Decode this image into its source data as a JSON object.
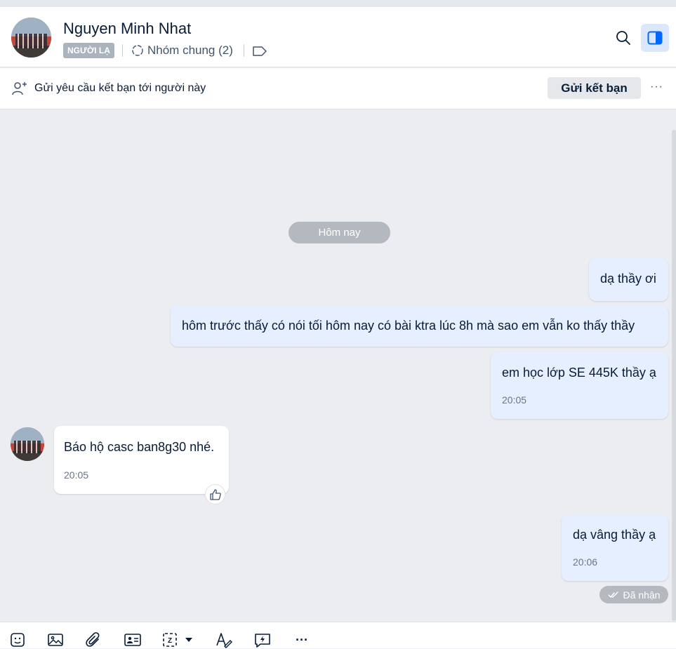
{
  "header": {
    "contact_name": "Nguyen Minh Nhat",
    "badge": "NGƯỜI LẠ",
    "group_label": "Nhóm chung (2)"
  },
  "friend_bar": {
    "text": "Gửi yêu cầu kết bạn tới người này",
    "button_label": "Gửi kết bạn",
    "more_label": "···"
  },
  "chat": {
    "date_divider": "Hôm nay",
    "messages": [
      {
        "from": "me",
        "text": "dạ thầy ơi"
      },
      {
        "from": "me",
        "text": "hôm trước thấy có nói tối hôm nay có bài ktra lúc 8h mà sao em vẫn ko thấy thầy"
      },
      {
        "from": "me",
        "text": "em học lớp SE 445K thầy ạ",
        "time": "20:05"
      },
      {
        "from": "them",
        "text": "Báo hộ casc ban8g30 nhé.",
        "time": "20:05"
      },
      {
        "from": "me",
        "text": "dạ vâng thầy ạ",
        "time": "20:06"
      }
    ],
    "status": "Đã nhận"
  },
  "toolbar": {
    "items": [
      "sticker-icon",
      "image-icon",
      "attachment-icon",
      "contact-card-icon",
      "screenshot-icon",
      "format-text-icon",
      "quick-message-icon",
      "more-icon"
    ],
    "more_label": "···"
  },
  "colors": {
    "my_bubble": "#e5efff",
    "their_bubble": "#ffffff",
    "accent": "#0068ff",
    "chat_bg": "#ebedf0"
  }
}
